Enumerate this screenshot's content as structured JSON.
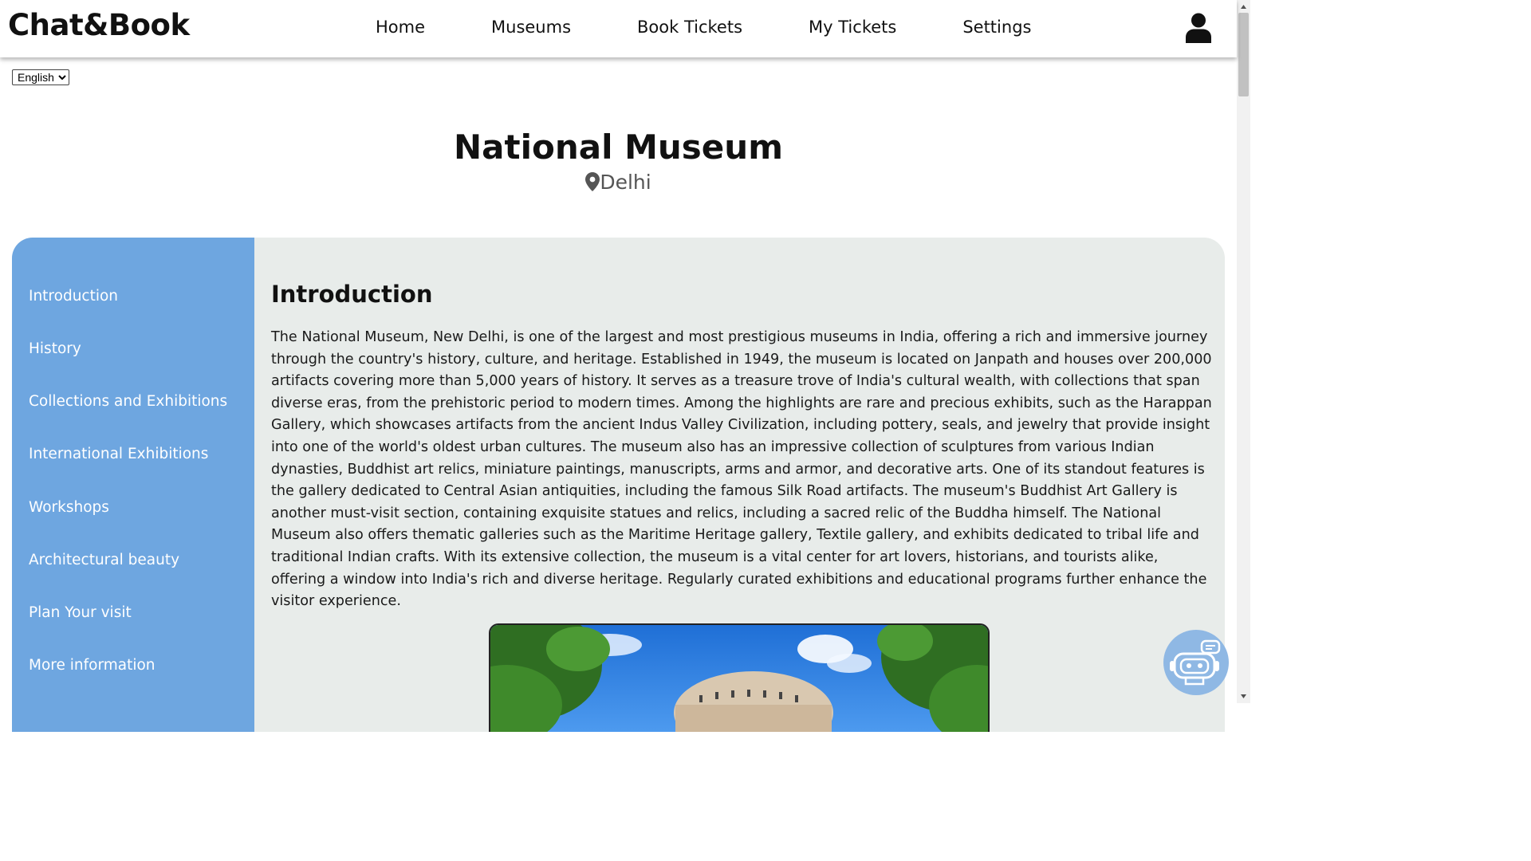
{
  "header": {
    "brand": "Chat&Book",
    "nav": [
      "Home",
      "Museums",
      "Book Tickets",
      "My Tickets",
      "Settings"
    ],
    "user_icon": "user-icon"
  },
  "language": {
    "selected": "English"
  },
  "museum": {
    "title": "National Museum",
    "location": "Delhi",
    "location_icon": "map-pin-icon"
  },
  "sidebar": {
    "items": [
      "Introduction",
      "History",
      "Collections and Exhibitions",
      "International Exhibitions",
      "Workshops",
      "Architectural beauty",
      "Plan Your visit",
      "More information"
    ]
  },
  "section": {
    "heading": "Introduction",
    "body": "The National Museum, New Delhi, is one of the largest and most prestigious museums in India, offering a rich and immersive journey through the country's history, culture, and heritage. Established in 1949, the museum is located on Janpath and houses over 200,000 artifacts covering more than 5,000 years of history. It serves as a treasure trove of India's cultural wealth, with collections that span diverse eras, from the prehistoric period to modern times. Among the highlights are rare and precious exhibits, such as the Harappan Gallery, which showcases artifacts from the ancient Indus Valley Civilization, including pottery, seals, and jewelry that provide insight into one of the world's oldest urban cultures. The museum also has an impressive collection of sculptures from various Indian dynasties, Buddhist art relics, miniature paintings, manuscripts, arms and armor, and decorative arts. One of its standout features is the gallery dedicated to Central Asian antiquities, including the famous Silk Road artifacts. The museum's Buddhist Art Gallery is another must-visit section, containing exquisite statues and relics, including a sacred relic of the Buddha himself. The National Museum also offers thematic galleries such as the Maritime Heritage gallery, Textile gallery, and exhibits dedicated to tribal life and traditional Indian crafts. With its extensive collection, the museum is a vital center for art lovers, historians, and tourists alike, offering a window into India's rich and diverse heritage. Regularly curated exhibitions and educational programs further enhance the visitor experience."
  },
  "chatbot": {
    "icon": "robot-icon"
  },
  "colors": {
    "sidebar": "#6ea6e0",
    "card": "#e8ecea",
    "chatbot": "#8fb8e4"
  }
}
